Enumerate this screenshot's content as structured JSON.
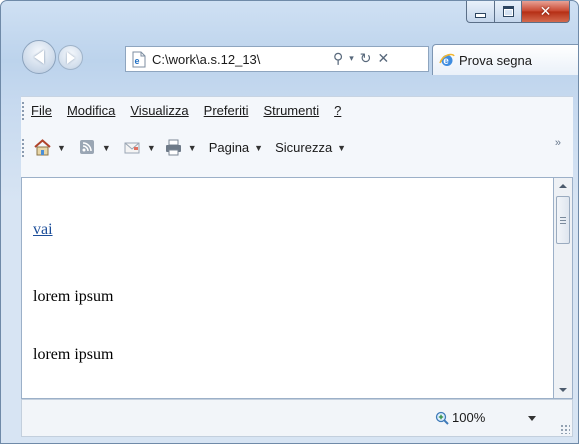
{
  "address_bar": {
    "url": "C:\\work\\a.s.12_13\\",
    "search_icon": "search-icon",
    "refresh_icon": "refresh-icon",
    "stop_icon": "stop-icon"
  },
  "tab": {
    "title": "Prova segna"
  },
  "menu": {
    "file": "File",
    "modifica": "Modifica",
    "visualizza": "Visualizza",
    "preferiti": "Preferiti",
    "strumenti": "Strumenti",
    "help": "?"
  },
  "command_bar": {
    "pagina": "Pagina",
    "sicurezza": "Sicurezza",
    "overflow": "»"
  },
  "content": {
    "link": "vai",
    "paragraphs": [
      "lorem ipsum",
      "lorem ipsum"
    ]
  },
  "status_bar": {
    "zoom": "100%"
  },
  "colors": {
    "link": "#1b4d99",
    "close_button": "#c7442c",
    "chrome": "#c6d9ef"
  }
}
